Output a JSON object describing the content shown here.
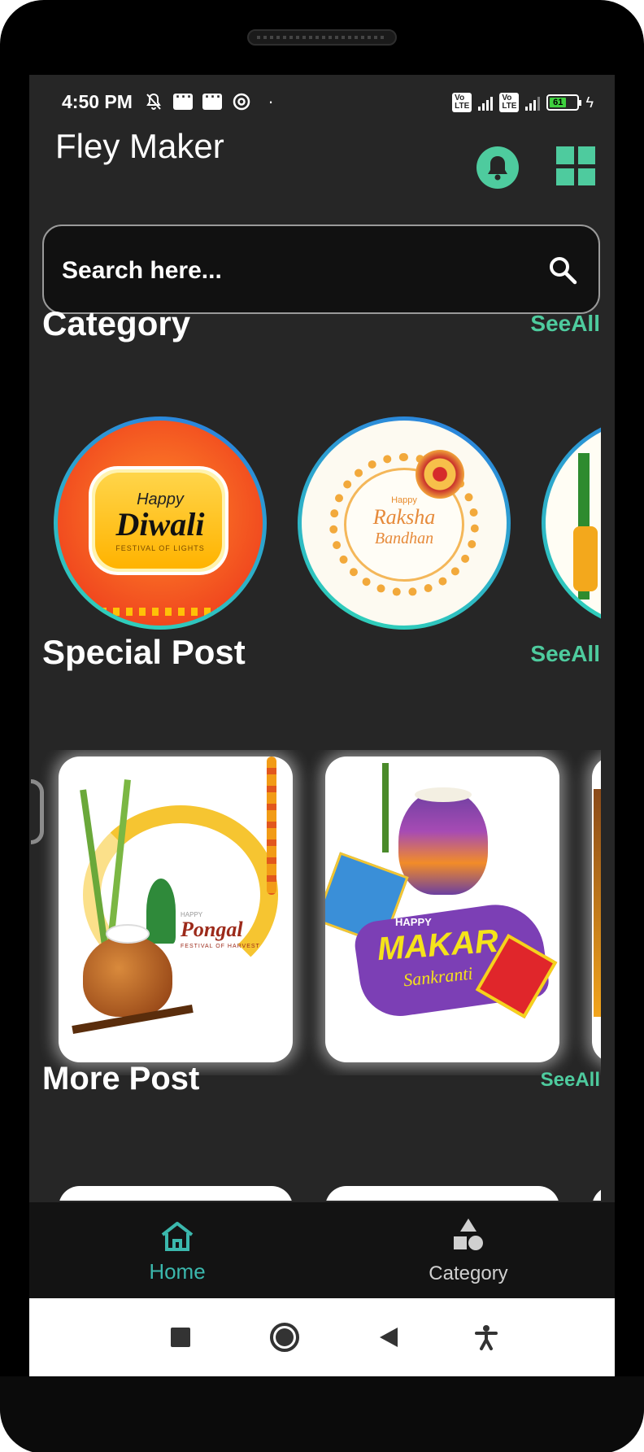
{
  "status_bar": {
    "time": "4:50 PM",
    "battery": "61",
    "network": "4G"
  },
  "app": {
    "title": "Fley Maker"
  },
  "search": {
    "placeholder": "Search here..."
  },
  "category_section": {
    "title": "Category",
    "see_all": "SeeAll",
    "items": [
      {
        "line1": "Happy",
        "line2": "Diwali",
        "line3": "FESTIVAL OF LIGHTS"
      },
      {
        "line1": "Happy",
        "line2": "Raksha",
        "line3": "Bandhan"
      }
    ]
  },
  "special_section": {
    "title": "Special Post",
    "see_all": "SeeAll",
    "items": [
      {
        "line1": "HAPPY",
        "line2": "Pongal",
        "line3": "FESTIVAL OF HARVEST"
      },
      {
        "line1": "HAPPY",
        "line2": "MAKAR",
        "line3": "Sankranti"
      }
    ]
  },
  "more_section": {
    "title": "More Post",
    "see_all": "SeeAll"
  },
  "bottom_nav": {
    "home": "Home",
    "category": "Category"
  },
  "colors": {
    "accent": "#4ecb9e",
    "nav_active": "#3bb8ad",
    "background": "#262626"
  }
}
